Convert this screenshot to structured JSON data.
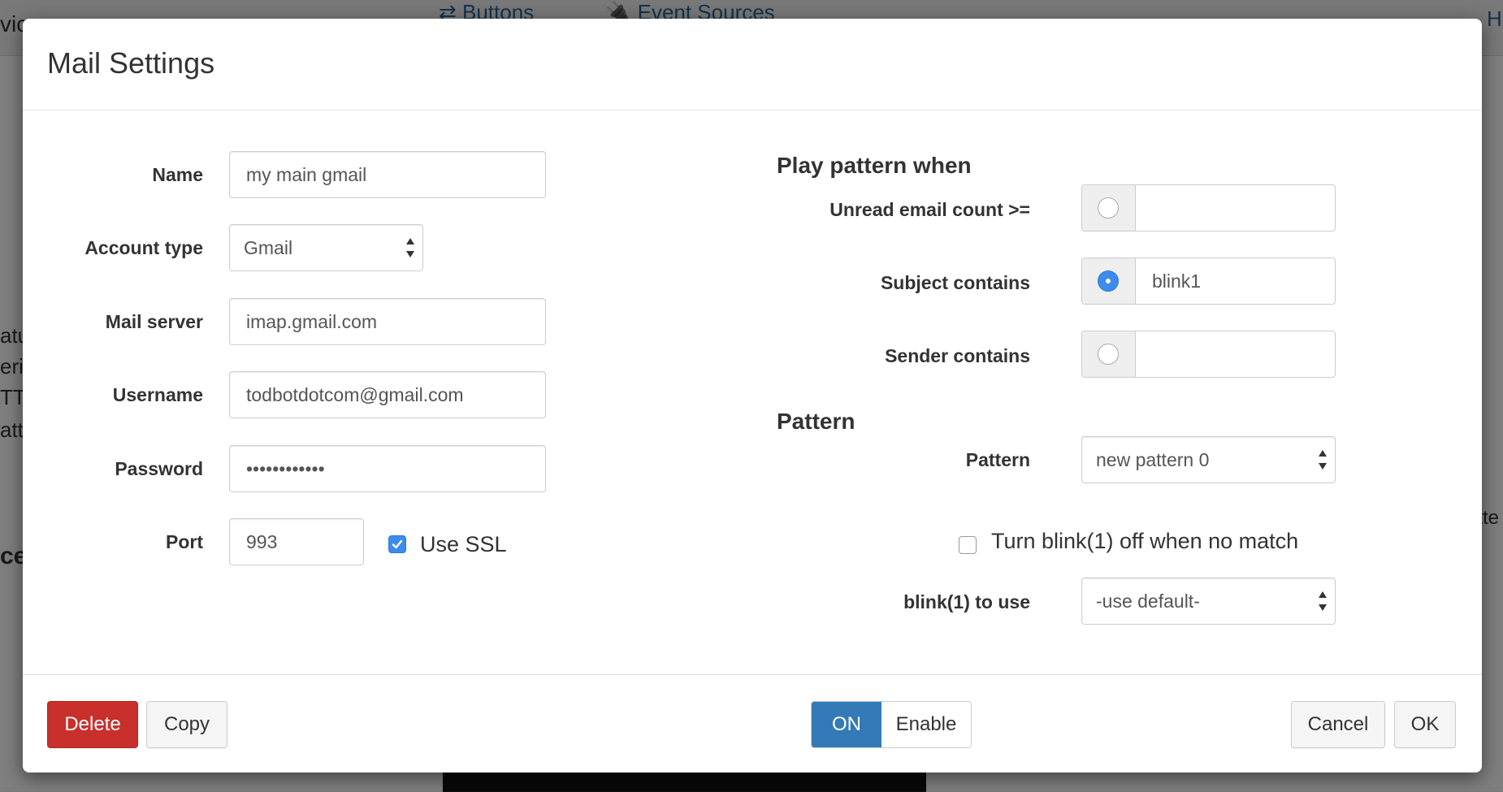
{
  "background": {
    "tabs": [
      "⇄ Buttons",
      "🔌 Event Sources"
    ],
    "fragments": [
      "vic",
      "atu",
      "eria",
      "TT",
      "atte",
      "ce",
      "atte",
      "H"
    ]
  },
  "modal": {
    "title": "Mail Settings",
    "left_form": {
      "name_label": "Name",
      "name_value": "my main gmail",
      "account_type_label": "Account type",
      "account_type_value": "Gmail",
      "mail_server_label": "Mail server",
      "mail_server_value": "imap.gmail.com",
      "username_label": "Username",
      "username_value": "todbotdotcom@gmail.com",
      "password_label": "Password",
      "password_value": "••••••••••••",
      "port_label": "Port",
      "port_value": "993",
      "use_ssl_label": "Use SSL",
      "use_ssl_checked": true
    },
    "right_form": {
      "play_pattern_heading": "Play pattern when",
      "unread_label": "Unread email count >=",
      "unread_value": "",
      "subject_label": "Subject contains",
      "subject_value": "blink1",
      "sender_label": "Sender contains",
      "sender_value": "",
      "selected_trigger": "subject",
      "pattern_heading": "Pattern",
      "pattern_label": "Pattern",
      "pattern_value": "new pattern 0",
      "turn_off_label": "Turn blink(1) off when no match",
      "turn_off_checked": false,
      "blink_to_use_label": "blink(1) to use",
      "blink_to_use_value": "-use default-"
    },
    "footer": {
      "delete_label": "Delete",
      "copy_label": "Copy",
      "toggle_on_label": "ON",
      "toggle_enable_label": "Enable",
      "cancel_label": "Cancel",
      "ok_label": "OK"
    }
  },
  "colors": {
    "primary": "#337ab7",
    "danger": "#c9302c",
    "checkbox_accent": "#3b8ced"
  }
}
